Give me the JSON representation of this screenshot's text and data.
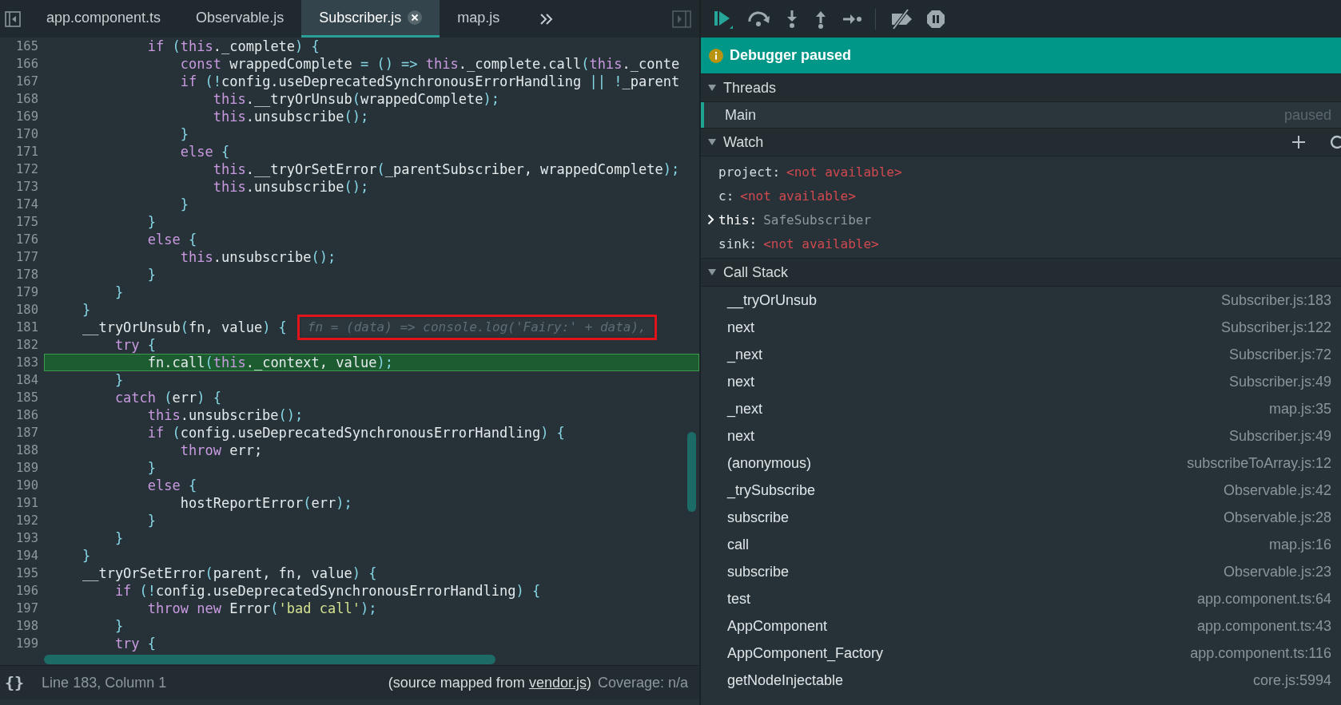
{
  "tabs": [
    {
      "label": "app.component.ts",
      "selected": false
    },
    {
      "label": "Observable.js",
      "selected": false
    },
    {
      "label": "Subscriber.js",
      "selected": true
    },
    {
      "label": "map.js",
      "selected": false
    }
  ],
  "editor": {
    "lines": [
      {
        "number": "165",
        "current": false,
        "segments": [
          {
            "text": "            if",
            "kind": "k"
          },
          {
            "text": " (",
            "kind": "c"
          },
          {
            "text": "this",
            "kind": "k"
          },
          {
            "text": "._complete",
            "kind": "p"
          },
          {
            "text": ") {",
            "kind": "c"
          }
        ]
      },
      {
        "number": "166",
        "current": false,
        "segments": [
          {
            "text": "                const",
            "kind": "k"
          },
          {
            "text": " wrappedComplete ",
            "kind": "p"
          },
          {
            "text": "= () => ",
            "kind": "c"
          },
          {
            "text": "this",
            "kind": "k"
          },
          {
            "text": "._complete.call",
            "kind": "p"
          },
          {
            "text": "(",
            "kind": "c"
          },
          {
            "text": "this",
            "kind": "k"
          },
          {
            "text": "._conte",
            "kind": "p"
          }
        ]
      },
      {
        "number": "167",
        "current": false,
        "segments": [
          {
            "text": "                if",
            "kind": "k"
          },
          {
            "text": " (!",
            "kind": "c"
          },
          {
            "text": "config.useDeprecatedSynchronousErrorHandling ",
            "kind": "p"
          },
          {
            "text": "|| !",
            "kind": "c"
          },
          {
            "text": "_parent",
            "kind": "p"
          }
        ]
      },
      {
        "number": "168",
        "current": false,
        "segments": [
          {
            "text": "                    this",
            "kind": "k"
          },
          {
            "text": ".__tryOrUnsub",
            "kind": "p"
          },
          {
            "text": "(",
            "kind": "c"
          },
          {
            "text": "wrappedComplete",
            "kind": "p"
          },
          {
            "text": ");",
            "kind": "c"
          }
        ]
      },
      {
        "number": "169",
        "current": false,
        "segments": [
          {
            "text": "                    this",
            "kind": "k"
          },
          {
            "text": ".unsubscribe",
            "kind": "p"
          },
          {
            "text": "();",
            "kind": "c"
          }
        ]
      },
      {
        "number": "170",
        "current": false,
        "segments": [
          {
            "text": "                }",
            "kind": "c"
          }
        ]
      },
      {
        "number": "171",
        "current": false,
        "segments": [
          {
            "text": "                else",
            "kind": "k"
          },
          {
            "text": " {",
            "kind": "c"
          }
        ]
      },
      {
        "number": "172",
        "current": false,
        "segments": [
          {
            "text": "                    this",
            "kind": "k"
          },
          {
            "text": ".__tryOrSetError",
            "kind": "p"
          },
          {
            "text": "(",
            "kind": "c"
          },
          {
            "text": "_parentSubscriber, wrappedComplete",
            "kind": "p"
          },
          {
            "text": ");",
            "kind": "c"
          }
        ]
      },
      {
        "number": "173",
        "current": false,
        "segments": [
          {
            "text": "                    this",
            "kind": "k"
          },
          {
            "text": ".unsubscribe",
            "kind": "p"
          },
          {
            "text": "();",
            "kind": "c"
          }
        ]
      },
      {
        "number": "174",
        "current": false,
        "segments": [
          {
            "text": "                }",
            "kind": "c"
          }
        ]
      },
      {
        "number": "175",
        "current": false,
        "segments": [
          {
            "text": "            }",
            "kind": "c"
          }
        ]
      },
      {
        "number": "176",
        "current": false,
        "segments": [
          {
            "text": "            else",
            "kind": "k"
          },
          {
            "text": " {",
            "kind": "c"
          }
        ]
      },
      {
        "number": "177",
        "current": false,
        "segments": [
          {
            "text": "                this",
            "kind": "k"
          },
          {
            "text": ".unsubscribe",
            "kind": "p"
          },
          {
            "text": "();",
            "kind": "c"
          }
        ]
      },
      {
        "number": "178",
        "current": false,
        "segments": [
          {
            "text": "            }",
            "kind": "c"
          }
        ]
      },
      {
        "number": "179",
        "current": false,
        "segments": [
          {
            "text": "        }",
            "kind": "c"
          }
        ]
      },
      {
        "number": "180",
        "current": false,
        "segments": [
          {
            "text": "    }",
            "kind": "c"
          }
        ]
      },
      {
        "number": "181",
        "current": false,
        "segments": [
          {
            "text": "    __tryOrUnsub",
            "kind": "p"
          },
          {
            "text": "(",
            "kind": "c"
          },
          {
            "text": "fn, value",
            "kind": "p"
          },
          {
            "text": ") {",
            "kind": "c"
          }
        ],
        "inline_value": {
          "text": "fn = (data) => console.log('Fairy:' + data),",
          "outlined": true
        }
      },
      {
        "number": "182",
        "current": false,
        "segments": [
          {
            "text": "        try",
            "kind": "k"
          },
          {
            "text": " {",
            "kind": "c"
          }
        ]
      },
      {
        "number": "183",
        "current": true,
        "segments": [
          {
            "text": "            fn.call",
            "kind": "p"
          },
          {
            "text": "(",
            "kind": "c"
          },
          {
            "text": "this",
            "kind": "k"
          },
          {
            "text": "._context, value",
            "kind": "p"
          },
          {
            "text": ");",
            "kind": "c"
          }
        ]
      },
      {
        "number": "184",
        "current": false,
        "segments": [
          {
            "text": "        }",
            "kind": "c"
          }
        ]
      },
      {
        "number": "185",
        "current": false,
        "segments": [
          {
            "text": "        catch",
            "kind": "k"
          },
          {
            "text": " (",
            "kind": "c"
          },
          {
            "text": "err",
            "kind": "p"
          },
          {
            "text": ") {",
            "kind": "c"
          }
        ]
      },
      {
        "number": "186",
        "current": false,
        "segments": [
          {
            "text": "            this",
            "kind": "k"
          },
          {
            "text": ".unsubscribe",
            "kind": "p"
          },
          {
            "text": "();",
            "kind": "c"
          }
        ]
      },
      {
        "number": "187",
        "current": false,
        "segments": [
          {
            "text": "            if",
            "kind": "k"
          },
          {
            "text": " (",
            "kind": "c"
          },
          {
            "text": "config.useDeprecatedSynchronousErrorHandling",
            "kind": "p"
          },
          {
            "text": ") {",
            "kind": "c"
          }
        ]
      },
      {
        "number": "188",
        "current": false,
        "segments": [
          {
            "text": "                throw",
            "kind": "k"
          },
          {
            "text": " err;",
            "kind": "p"
          }
        ]
      },
      {
        "number": "189",
        "current": false,
        "segments": [
          {
            "text": "            }",
            "kind": "c"
          }
        ]
      },
      {
        "number": "190",
        "current": false,
        "segments": [
          {
            "text": "            else",
            "kind": "k"
          },
          {
            "text": " {",
            "kind": "c"
          }
        ]
      },
      {
        "number": "191",
        "current": false,
        "segments": [
          {
            "text": "                hostReportError",
            "kind": "p"
          },
          {
            "text": "(",
            "kind": "c"
          },
          {
            "text": "err",
            "kind": "p"
          },
          {
            "text": ");",
            "kind": "c"
          }
        ]
      },
      {
        "number": "192",
        "current": false,
        "segments": [
          {
            "text": "            }",
            "kind": "c"
          }
        ]
      },
      {
        "number": "193",
        "current": false,
        "segments": [
          {
            "text": "        }",
            "kind": "c"
          }
        ]
      },
      {
        "number": "194",
        "current": false,
        "segments": [
          {
            "text": "    }",
            "kind": "c"
          }
        ]
      },
      {
        "number": "195",
        "current": false,
        "segments": [
          {
            "text": "    __tryOrSetError",
            "kind": "p"
          },
          {
            "text": "(",
            "kind": "c"
          },
          {
            "text": "parent, fn, value",
            "kind": "p"
          },
          {
            "text": ") {",
            "kind": "c"
          }
        ]
      },
      {
        "number": "196",
        "current": false,
        "segments": [
          {
            "text": "        if",
            "kind": "k"
          },
          {
            "text": " (!",
            "kind": "c"
          },
          {
            "text": "config.useDeprecatedSynchronousErrorHandling",
            "kind": "p"
          },
          {
            "text": ") {",
            "kind": "c"
          }
        ]
      },
      {
        "number": "197",
        "current": false,
        "segments": [
          {
            "text": "            throw new",
            "kind": "k"
          },
          {
            "text": " Error",
            "kind": "p"
          },
          {
            "text": "(",
            "kind": "c"
          },
          {
            "text": "'bad call'",
            "kind": "s"
          },
          {
            "text": ");",
            "kind": "c"
          }
        ]
      },
      {
        "number": "198",
        "current": false,
        "segments": [
          {
            "text": "        }",
            "kind": "c"
          }
        ]
      },
      {
        "number": "199",
        "current": false,
        "segments": [
          {
            "text": "        try",
            "kind": "k"
          },
          {
            "text": " {",
            "kind": "c"
          }
        ]
      }
    ]
  },
  "status_bar": {
    "format_button": "{}",
    "position": "Line 183, Column 1",
    "source_prefix": "(source mapped from ",
    "source_link": "vendor.js",
    "source_suffix": ")",
    "coverage": "Coverage: n/a"
  },
  "debugger": {
    "banner": "Debugger paused",
    "threads": {
      "title": "Threads",
      "expanded": true,
      "items": [
        {
          "name": "Main",
          "status": "paused",
          "selected": true
        }
      ]
    },
    "watch": {
      "title": "Watch",
      "expanded": true,
      "items": [
        {
          "name": "project:",
          "value": "<not available>",
          "kind": "unavailable"
        },
        {
          "name": "c:",
          "value": "<not available>",
          "kind": "unavailable"
        },
        {
          "name": "this:",
          "value": "SafeSubscriber",
          "kind": "object"
        },
        {
          "name": "sink:",
          "value": "<not available>",
          "kind": "unavailable"
        }
      ]
    },
    "call_stack": {
      "title": "Call Stack",
      "expanded": true,
      "frames": [
        {
          "function": "__tryOrUnsub",
          "location": "Subscriber.js:183"
        },
        {
          "function": "next",
          "location": "Subscriber.js:122"
        },
        {
          "function": "_next",
          "location": "Subscriber.js:72"
        },
        {
          "function": "next",
          "location": "Subscriber.js:49"
        },
        {
          "function": "_next",
          "location": "map.js:35"
        },
        {
          "function": "next",
          "location": "Subscriber.js:49"
        },
        {
          "function": "(anonymous)",
          "location": "subscribeToArray.js:12"
        },
        {
          "function": "_trySubscribe",
          "location": "Observable.js:42"
        },
        {
          "function": "subscribe",
          "location": "Observable.js:28"
        },
        {
          "function": "call",
          "location": "map.js:16"
        },
        {
          "function": "subscribe",
          "location": "Observable.js:23"
        },
        {
          "function": "test",
          "location": "app.component.ts:64"
        },
        {
          "function": "AppComponent",
          "location": "app.component.ts:43"
        },
        {
          "function": "AppComponent_Factory",
          "location": "app.component.ts:116"
        },
        {
          "function": "getNodeInjectable",
          "location": "core.js:5994"
        }
      ]
    }
  }
}
